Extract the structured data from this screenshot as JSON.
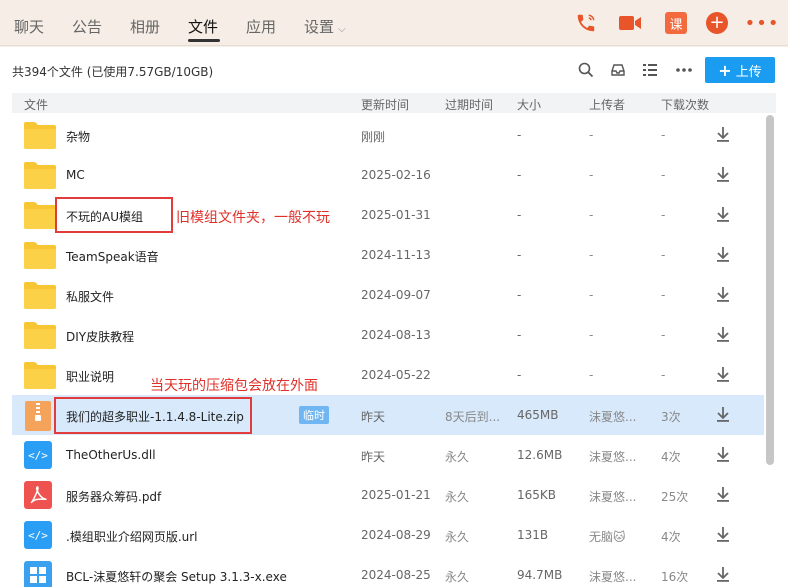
{
  "tabs": [
    {
      "label": "聊天"
    },
    {
      "label": "公告"
    },
    {
      "label": "相册"
    },
    {
      "label": "文件",
      "active": true
    },
    {
      "label": "应用"
    },
    {
      "label": "设置"
    }
  ],
  "top_icons": {
    "course_label": "课"
  },
  "summary": "共394个文件 (已使用7.57GB/10GB)",
  "upload_label": "上传",
  "columns": {
    "file": "文件",
    "updated": "更新时间",
    "expiry": "过期时间",
    "size": "大小",
    "uploader": "上传者",
    "downloads": "下载次数"
  },
  "files": [
    {
      "type": "folder",
      "name": "杂物",
      "updated": "刚刚",
      "expiry": "",
      "size": "-",
      "uploader": "-",
      "downloads": "-"
    },
    {
      "type": "folder",
      "name": "MC",
      "updated": "2025-02-16",
      "expiry": "",
      "size": "-",
      "uploader": "-",
      "downloads": "-"
    },
    {
      "type": "folder",
      "name": "不玩的AU模组",
      "updated": "2025-01-31",
      "expiry": "",
      "size": "-",
      "uploader": "-",
      "downloads": "-"
    },
    {
      "type": "folder",
      "name": "TeamSpeak语音",
      "updated": "2024-11-13",
      "expiry": "",
      "size": "-",
      "uploader": "-",
      "downloads": "-"
    },
    {
      "type": "folder",
      "name": "私服文件",
      "updated": "2024-09-07",
      "expiry": "",
      "size": "-",
      "uploader": "-",
      "downloads": "-"
    },
    {
      "type": "folder",
      "name": "DIY皮肤教程",
      "updated": "2024-08-13",
      "expiry": "",
      "size": "-",
      "uploader": "-",
      "downloads": "-"
    },
    {
      "type": "folder",
      "name": "职业说明",
      "updated": "2024-05-22",
      "expiry": "",
      "size": "-",
      "uploader": "-",
      "downloads": "-"
    },
    {
      "type": "zip",
      "name": "我们的超多职业-1.1.4.8-Lite.zip",
      "badge": "临时",
      "updated": "昨天",
      "expiry": "8天后到...",
      "size": "465MB",
      "uploader": "沫夏悠...",
      "downloads": "3次",
      "selected": true
    },
    {
      "type": "code",
      "name": "TheOtherUs.dll",
      "updated": "昨天",
      "expiry": "永久",
      "size": "12.6MB",
      "uploader": "沫夏悠...",
      "downloads": "4次"
    },
    {
      "type": "pdf",
      "name": "服务器众筹码.pdf",
      "updated": "2025-01-21",
      "expiry": "永久",
      "size": "165KB",
      "uploader": "沫夏悠...",
      "downloads": "25次"
    },
    {
      "type": "code",
      "name": ".模组职业介绍网页版.url",
      "updated": "2024-08-29",
      "expiry": "永久",
      "size": "131B",
      "uploader": "无脑🐱",
      "downloads": "4次"
    },
    {
      "type": "exe",
      "name": "BCL-沫夏悠轩の聚会 Setup 3.1.3-x.exe",
      "updated": "2024-08-25",
      "expiry": "永久",
      "size": "94.7MB",
      "uploader": "沫夏悠...",
      "downloads": "16次"
    }
  ],
  "annotations": {
    "note1": "旧模组文件夹，一般不玩",
    "note2": "当天玩的压缩包会放在外面"
  },
  "colors": {
    "accent": "#1a9cf0",
    "brand": "#e8552a",
    "annotation": "#e0302a",
    "folder": "#f9c633"
  }
}
